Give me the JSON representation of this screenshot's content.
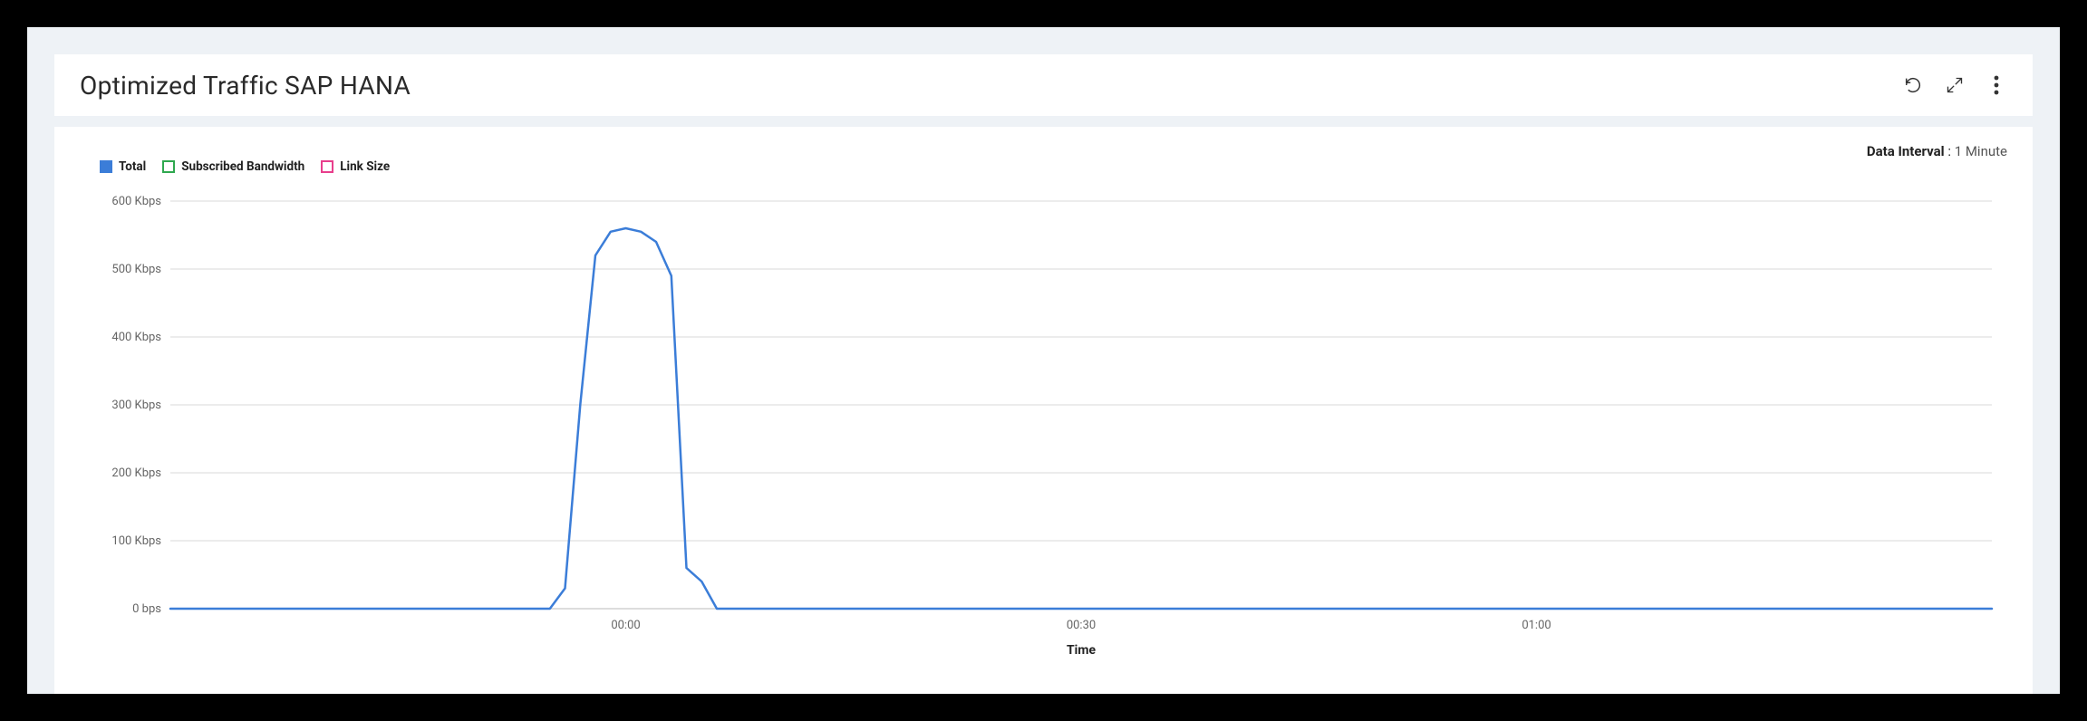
{
  "header": {
    "title": "Optimized Traffic SAP HANA"
  },
  "data_interval": {
    "label": "Data Interval",
    "value": "1 Minute"
  },
  "legend": [
    {
      "name": "Total",
      "swatch": "swatch-total"
    },
    {
      "name": "Subscribed Bandwidth",
      "swatch": "swatch-sub"
    },
    {
      "name": "Link Size",
      "swatch": "swatch-link"
    }
  ],
  "chart_data": {
    "type": "line",
    "title": "Optimized Traffic SAP HANA",
    "xlabel": "Time",
    "ylabel": "",
    "y_ticks": [
      "0 bps",
      "100 Kbps",
      "200 Kbps",
      "300 Kbps",
      "400 Kbps",
      "500 Kbps",
      "600 Kbps"
    ],
    "y_values": [
      0,
      100,
      200,
      300,
      400,
      500,
      600
    ],
    "ylim": [
      0,
      600
    ],
    "x_ticks": [
      "00:00",
      "00:30",
      "01:00"
    ],
    "x_tick_positions": [
      0,
      30,
      60
    ],
    "xlim": [
      -30,
      90
    ],
    "series": [
      {
        "name": "Total",
        "color": "#3b7dd8",
        "x": [
          -30,
          -5,
          -4,
          -3,
          -2,
          -1,
          0,
          1,
          2,
          3,
          4,
          5,
          6,
          90
        ],
        "values": [
          0,
          0,
          30,
          300,
          520,
          555,
          560,
          555,
          540,
          490,
          60,
          40,
          0,
          0
        ]
      }
    ]
  }
}
